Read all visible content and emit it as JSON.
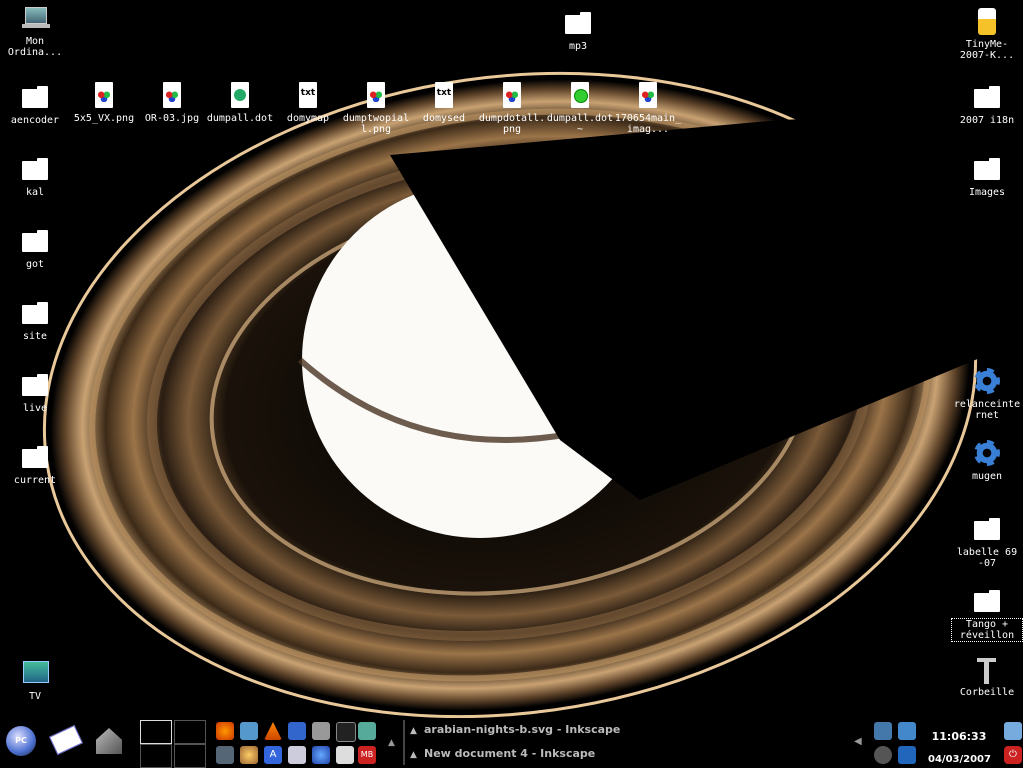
{
  "desktop": {
    "icons_left": [
      {
        "label": "Mon Ordina...",
        "icon": "computer-icon",
        "type": "laptop"
      },
      {
        "label": "aencoder",
        "icon": "folder-icon",
        "type": "folder"
      },
      {
        "label": "kal",
        "icon": "folder-icon",
        "type": "folder"
      },
      {
        "label": "got",
        "icon": "folder-icon",
        "type": "folder"
      },
      {
        "label": "site",
        "icon": "folder-icon",
        "type": "folder"
      },
      {
        "label": "live",
        "icon": "folder-icon",
        "type": "folder"
      },
      {
        "label": "current",
        "icon": "folder-icon",
        "type": "folder"
      },
      {
        "label": "TV",
        "icon": "tv-icon",
        "type": "tv"
      }
    ],
    "icons_top": [
      {
        "label": "5x5_VX.png",
        "icon": "image-file-icon",
        "type": "png"
      },
      {
        "label": "OR-03.jpg",
        "icon": "image-file-icon",
        "type": "png"
      },
      {
        "label": "dumpall.dot",
        "icon": "dot-file-icon",
        "type": "dot"
      },
      {
        "label": "domymap",
        "icon": "text-file-icon",
        "type": "txt"
      },
      {
        "label": "dumptwopiall.png",
        "icon": "image-file-icon",
        "type": "png"
      },
      {
        "label": "domysed",
        "icon": "text-file-icon",
        "type": "txt"
      },
      {
        "label": "dumpdotall.png",
        "icon": "image-file-icon",
        "type": "png"
      },
      {
        "label": "dumpall.dot~",
        "icon": "dot-backup-file-icon",
        "type": "dotx"
      },
      {
        "label": "170654main_imag...",
        "icon": "image-file-icon",
        "type": "png"
      }
    ],
    "icon_mp3": {
      "label": "mp3",
      "icon": "folder-icon"
    },
    "icons_right": [
      {
        "label": "TinyMe-2007-K...",
        "icon": "archive-icon",
        "type": "jar"
      },
      {
        "label": "2007 i18n",
        "icon": "folder-icon",
        "type": "folder"
      },
      {
        "label": "Images",
        "icon": "folder-icon",
        "type": "folder"
      },
      {
        "label": "relanceinternet",
        "icon": "gear-icon",
        "type": "gear"
      },
      {
        "label": "mugen",
        "icon": "gear-icon",
        "type": "gear"
      },
      {
        "label": "labelle 69 -07",
        "icon": "folder-icon",
        "type": "folder"
      },
      {
        "label": "Tango + réveillon",
        "icon": "folder-icon",
        "type": "folder",
        "selected": true
      },
      {
        "label": "Corbeille",
        "icon": "trash-icon",
        "type": "trash"
      }
    ]
  },
  "taskbar": {
    "kmenu_label": "PC",
    "tasks": [
      {
        "title": "arabian-nights-b.svg - Inkscape"
      },
      {
        "title": "New document 4 - Inkscape"
      }
    ],
    "clock": "11:06:33",
    "date": "04/03/2007",
    "launcher_a": "A",
    "launcher_mb": "MB"
  },
  "colors": {
    "background": "#000000",
    "ring": "#b48a5c",
    "planet": "#ffffff"
  }
}
